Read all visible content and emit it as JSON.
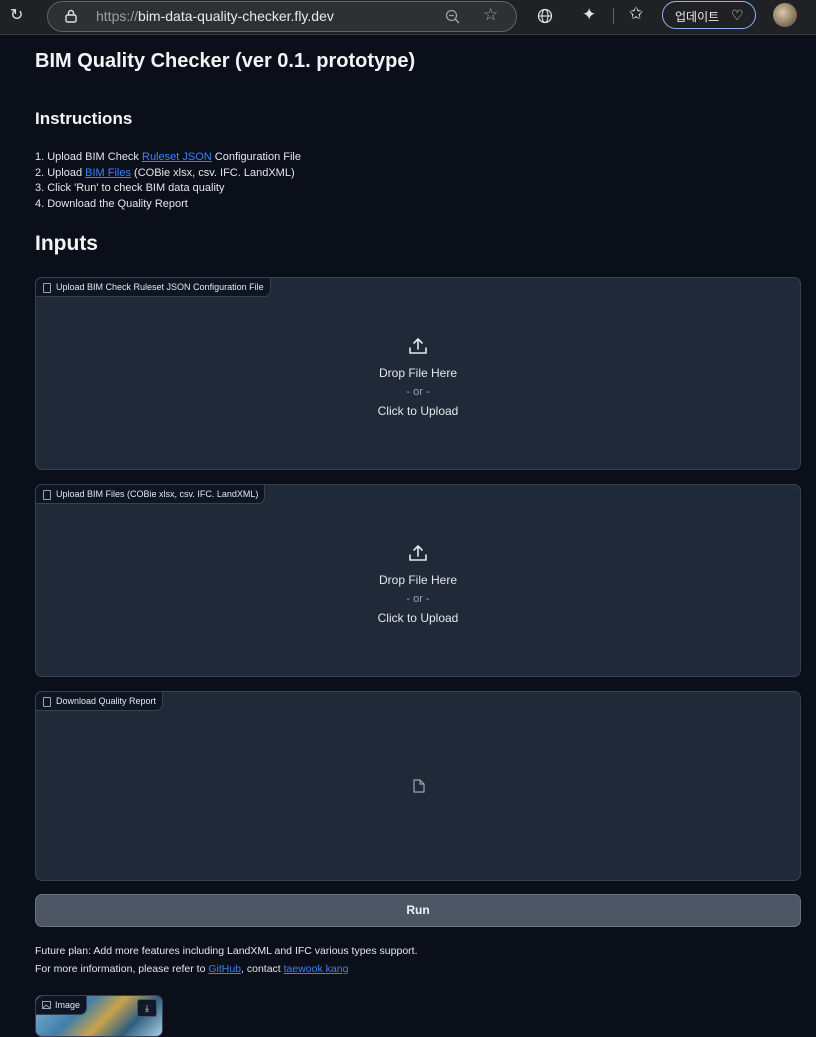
{
  "browser": {
    "url_proto": "https://",
    "url_host": "bim-data-quality-checker.fly.dev",
    "update_label": "업데이트"
  },
  "page": {
    "title": "BIM Quality Checker (ver 0.1. prototype)",
    "instructions_heading": "Instructions",
    "instructions": {
      "l1_pre": "1. Upload BIM Check ",
      "l1_link": "Ruleset JSON",
      "l1_post": " Configuration File",
      "l2_pre": "2. Upload ",
      "l2_link": "BIM Files",
      "l2_post": " (COBie xlsx, csv. IFC. LandXML)",
      "l3": "3. Click 'Run' to check BIM data quality",
      "l4": "4. Download the Quality Report"
    },
    "inputs_heading": "Inputs"
  },
  "upload_ruleset": {
    "label": "Upload BIM Check Ruleset JSON Configuration File",
    "drop_text": "Drop File Here",
    "or_text": "- or -",
    "click_text": "Click to Upload"
  },
  "upload_bim": {
    "label": "Upload BIM Files (COBie xlsx, csv. IFC. LandXML)",
    "drop_text": "Drop File Here",
    "or_text": "- or -",
    "click_text": "Click to Upload"
  },
  "download": {
    "label": "Download Quality Report"
  },
  "run_button": {
    "label": "Run"
  },
  "footer": {
    "line1": "Future plan: Add more features including LandXML and IFC various types support.",
    "line2_pre": "For more information, please refer to ",
    "github_link": "GitHub",
    "line2_mid": ", contact ",
    "contact_link": "taewook kang"
  },
  "image_panel": {
    "label": "Image"
  }
}
